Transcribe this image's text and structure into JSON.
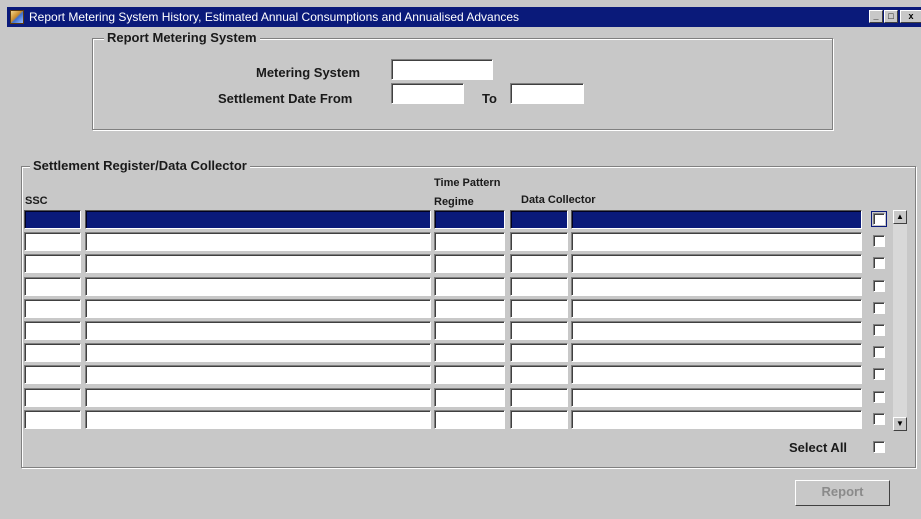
{
  "window": {
    "title": "Report Metering System History, Estimated Annual Consumptions and Annualised Advances",
    "minimize_label": "_",
    "maximize_label": "□",
    "close_label": "x"
  },
  "report_metering_system": {
    "group_title": "Report Metering System",
    "metering_system_label": "Metering System",
    "metering_system_value": "",
    "settlement_date_from_label": "Settlement Date From",
    "settlement_date_from_value": "",
    "to_label": "To",
    "to_value": ""
  },
  "settlement_register": {
    "group_title": "Settlement Register/Data Collector",
    "columns": {
      "ssc": "SSC",
      "time_pattern_regime_line1": "Time Pattern",
      "time_pattern_regime_line2": "Regime",
      "data_collector": "Data Collector"
    },
    "rows": [
      {
        "ssc": "",
        "description": "",
        "tpr": "",
        "dc_id": "",
        "dc_name": "",
        "selected": false
      },
      {
        "ssc": "",
        "description": "",
        "tpr": "",
        "dc_id": "",
        "dc_name": "",
        "selected": false
      },
      {
        "ssc": "",
        "description": "",
        "tpr": "",
        "dc_id": "",
        "dc_name": "",
        "selected": false
      },
      {
        "ssc": "",
        "description": "",
        "tpr": "",
        "dc_id": "",
        "dc_name": "",
        "selected": false
      },
      {
        "ssc": "",
        "description": "",
        "tpr": "",
        "dc_id": "",
        "dc_name": "",
        "selected": false
      },
      {
        "ssc": "",
        "description": "",
        "tpr": "",
        "dc_id": "",
        "dc_name": "",
        "selected": false
      },
      {
        "ssc": "",
        "description": "",
        "tpr": "",
        "dc_id": "",
        "dc_name": "",
        "selected": false
      },
      {
        "ssc": "",
        "description": "",
        "tpr": "",
        "dc_id": "",
        "dc_name": "",
        "selected": false
      },
      {
        "ssc": "",
        "description": "",
        "tpr": "",
        "dc_id": "",
        "dc_name": "",
        "selected": false
      },
      {
        "ssc": "",
        "description": "",
        "tpr": "",
        "dc_id": "",
        "dc_name": "",
        "selected": false
      }
    ],
    "select_all_label": "Select All",
    "select_all_checked": false
  },
  "report_button_label": "Report",
  "colors": {
    "title_bar": "#0a1a7a",
    "window_bg": "#c8c8c8",
    "selected_row": "#0a1a7a",
    "disabled_text": "#8a8a8a"
  },
  "icons": {
    "app": "oracle-forms-app-icon",
    "scroll_up": "arrow-up-icon",
    "scroll_down": "arrow-down-icon"
  }
}
